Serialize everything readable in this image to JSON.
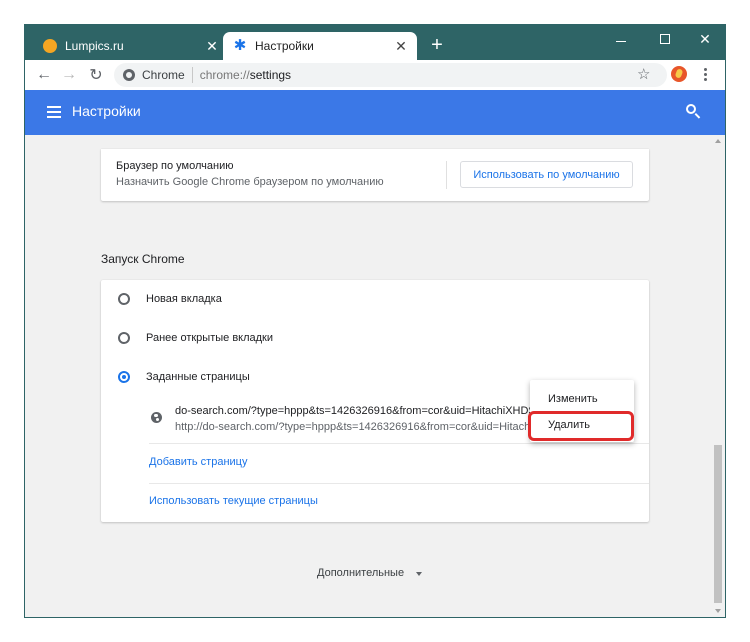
{
  "tabs": [
    {
      "title": "Lumpics.ru",
      "icon": "orange-circle-icon",
      "active": false
    },
    {
      "title": "Настройки",
      "icon": "gear-icon",
      "active": true
    }
  ],
  "toolbar": {
    "chip": "Chrome",
    "url_scheme": "chrome://",
    "url_path": "settings"
  },
  "appbar": {
    "title": "Настройки"
  },
  "default_browser": {
    "title": "Браузер по умолчанию",
    "subtitle": "Назначить Google Chrome браузером по умолчанию",
    "button": "Использовать по умолчанию"
  },
  "startup": {
    "section_title": "Запуск Chrome",
    "options": [
      {
        "label": "Новая вкладка",
        "checked": false
      },
      {
        "label": "Ранее открытые вкладки",
        "checked": false
      },
      {
        "label": "Заданные страницы",
        "checked": true
      }
    ],
    "page": {
      "title": "do-search.com/?type=hppp&ts=1426326916&from=cor&uid=HitachiXHDS72",
      "url": "http://do-search.com/?type=hppp&ts=1426326916&from=cor&uid=HitachiXH"
    },
    "add_page": "Добавить страницу",
    "use_current": "Использовать текущие страницы"
  },
  "advanced": "Дополнительные",
  "context_menu": {
    "edit": "Изменить",
    "delete": "Удалить"
  },
  "colors": {
    "titlebar": "#2e6466",
    "appbar": "#3b78e7",
    "link": "#1a73e8",
    "highlight": "#e02a2a"
  }
}
